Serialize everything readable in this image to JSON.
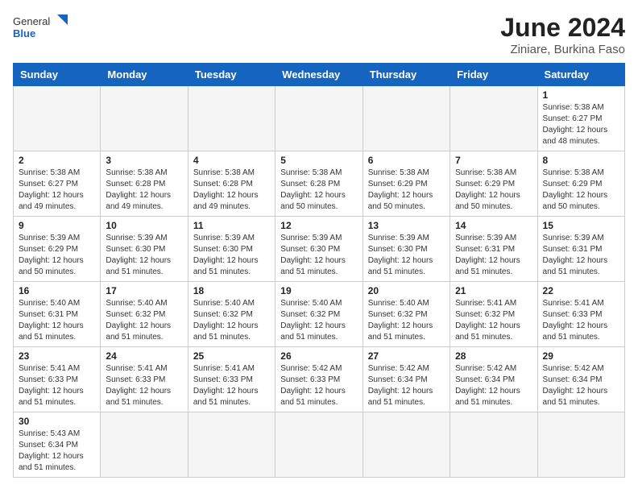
{
  "logo": {
    "text_general": "General",
    "text_blue": "Blue"
  },
  "header": {
    "title": "June 2024",
    "subtitle": "Ziniare, Burkina Faso"
  },
  "weekdays": [
    "Sunday",
    "Monday",
    "Tuesday",
    "Wednesday",
    "Thursday",
    "Friday",
    "Saturday"
  ],
  "days": [
    {
      "day": "",
      "info": ""
    },
    {
      "day": "",
      "info": ""
    },
    {
      "day": "",
      "info": ""
    },
    {
      "day": "",
      "info": ""
    },
    {
      "day": "",
      "info": ""
    },
    {
      "day": "",
      "info": ""
    },
    {
      "day": "1",
      "info": "Sunrise: 5:38 AM\nSunset: 6:27 PM\nDaylight: 12 hours and 48 minutes."
    },
    {
      "day": "2",
      "info": "Sunrise: 5:38 AM\nSunset: 6:27 PM\nDaylight: 12 hours and 49 minutes."
    },
    {
      "day": "3",
      "info": "Sunrise: 5:38 AM\nSunset: 6:28 PM\nDaylight: 12 hours and 49 minutes."
    },
    {
      "day": "4",
      "info": "Sunrise: 5:38 AM\nSunset: 6:28 PM\nDaylight: 12 hours and 49 minutes."
    },
    {
      "day": "5",
      "info": "Sunrise: 5:38 AM\nSunset: 6:28 PM\nDaylight: 12 hours and 50 minutes."
    },
    {
      "day": "6",
      "info": "Sunrise: 5:38 AM\nSunset: 6:29 PM\nDaylight: 12 hours and 50 minutes."
    },
    {
      "day": "7",
      "info": "Sunrise: 5:38 AM\nSunset: 6:29 PM\nDaylight: 12 hours and 50 minutes."
    },
    {
      "day": "8",
      "info": "Sunrise: 5:38 AM\nSunset: 6:29 PM\nDaylight: 12 hours and 50 minutes."
    },
    {
      "day": "9",
      "info": "Sunrise: 5:39 AM\nSunset: 6:29 PM\nDaylight: 12 hours and 50 minutes."
    },
    {
      "day": "10",
      "info": "Sunrise: 5:39 AM\nSunset: 6:30 PM\nDaylight: 12 hours and 51 minutes."
    },
    {
      "day": "11",
      "info": "Sunrise: 5:39 AM\nSunset: 6:30 PM\nDaylight: 12 hours and 51 minutes."
    },
    {
      "day": "12",
      "info": "Sunrise: 5:39 AM\nSunset: 6:30 PM\nDaylight: 12 hours and 51 minutes."
    },
    {
      "day": "13",
      "info": "Sunrise: 5:39 AM\nSunset: 6:30 PM\nDaylight: 12 hours and 51 minutes."
    },
    {
      "day": "14",
      "info": "Sunrise: 5:39 AM\nSunset: 6:31 PM\nDaylight: 12 hours and 51 minutes."
    },
    {
      "day": "15",
      "info": "Sunrise: 5:39 AM\nSunset: 6:31 PM\nDaylight: 12 hours and 51 minutes."
    },
    {
      "day": "16",
      "info": "Sunrise: 5:40 AM\nSunset: 6:31 PM\nDaylight: 12 hours and 51 minutes."
    },
    {
      "day": "17",
      "info": "Sunrise: 5:40 AM\nSunset: 6:32 PM\nDaylight: 12 hours and 51 minutes."
    },
    {
      "day": "18",
      "info": "Sunrise: 5:40 AM\nSunset: 6:32 PM\nDaylight: 12 hours and 51 minutes."
    },
    {
      "day": "19",
      "info": "Sunrise: 5:40 AM\nSunset: 6:32 PM\nDaylight: 12 hours and 51 minutes."
    },
    {
      "day": "20",
      "info": "Sunrise: 5:40 AM\nSunset: 6:32 PM\nDaylight: 12 hours and 51 minutes."
    },
    {
      "day": "21",
      "info": "Sunrise: 5:41 AM\nSunset: 6:32 PM\nDaylight: 12 hours and 51 minutes."
    },
    {
      "day": "22",
      "info": "Sunrise: 5:41 AM\nSunset: 6:33 PM\nDaylight: 12 hours and 51 minutes."
    },
    {
      "day": "23",
      "info": "Sunrise: 5:41 AM\nSunset: 6:33 PM\nDaylight: 12 hours and 51 minutes."
    },
    {
      "day": "24",
      "info": "Sunrise: 5:41 AM\nSunset: 6:33 PM\nDaylight: 12 hours and 51 minutes."
    },
    {
      "day": "25",
      "info": "Sunrise: 5:41 AM\nSunset: 6:33 PM\nDaylight: 12 hours and 51 minutes."
    },
    {
      "day": "26",
      "info": "Sunrise: 5:42 AM\nSunset: 6:33 PM\nDaylight: 12 hours and 51 minutes."
    },
    {
      "day": "27",
      "info": "Sunrise: 5:42 AM\nSunset: 6:34 PM\nDaylight: 12 hours and 51 minutes."
    },
    {
      "day": "28",
      "info": "Sunrise: 5:42 AM\nSunset: 6:34 PM\nDaylight: 12 hours and 51 minutes."
    },
    {
      "day": "29",
      "info": "Sunrise: 5:42 AM\nSunset: 6:34 PM\nDaylight: 12 hours and 51 minutes."
    },
    {
      "day": "30",
      "info": "Sunrise: 5:43 AM\nSunset: 6:34 PM\nDaylight: 12 hours and 51 minutes."
    },
    {
      "day": "",
      "info": ""
    },
    {
      "day": "",
      "info": ""
    },
    {
      "day": "",
      "info": ""
    },
    {
      "day": "",
      "info": ""
    },
    {
      "day": "",
      "info": ""
    },
    {
      "day": "",
      "info": ""
    }
  ]
}
